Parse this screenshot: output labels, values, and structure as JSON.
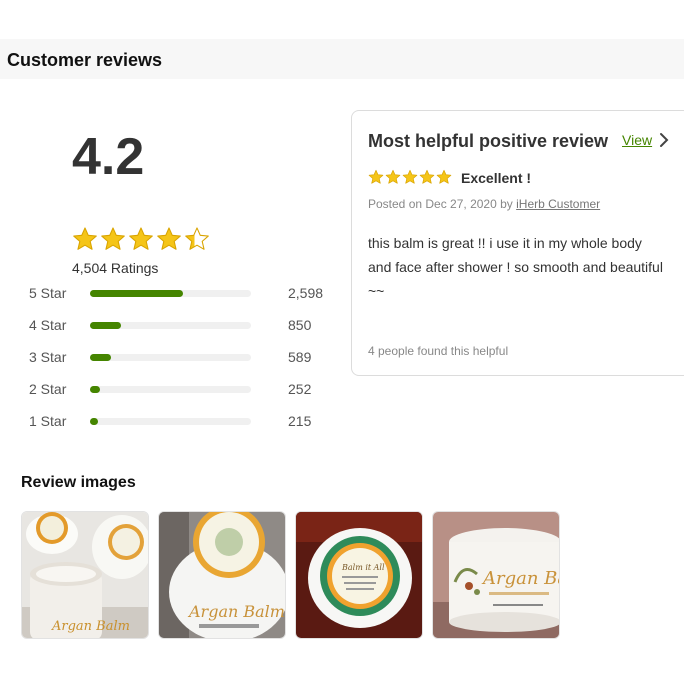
{
  "section_title": "Customer reviews",
  "summary": {
    "average": "4.2",
    "average_value": 4.2,
    "max_stars": 5,
    "ratings_label": "4,504 Ratings"
  },
  "histogram": [
    {
      "label": "5 Star",
      "count": "2,598",
      "fraction": 0.58
    },
    {
      "label": "4 Star",
      "count": "850",
      "fraction": 0.19
    },
    {
      "label": "3 Star",
      "count": "589",
      "fraction": 0.13
    },
    {
      "label": "2 Star",
      "count": "252",
      "fraction": 0.06
    },
    {
      "label": "1 Star",
      "count": "215",
      "fraction": 0.05
    }
  ],
  "helpful_review": {
    "title": "Most helpful positive review",
    "view_label": "View",
    "stars": 5,
    "headline": "Excellent !",
    "posted_prefix": "Posted on Dec 27, 2020 by",
    "author": "iHerb Customer",
    "body": "this balm is great !! i use it in my whole body and face after shower ! so smooth and beautiful ~~",
    "helpful_text": "4 people found this helpful"
  },
  "review_images": {
    "title": "Review images",
    "images": [
      {
        "name": "review-image-1"
      },
      {
        "name": "review-image-2",
        "label": "Argan Balm"
      },
      {
        "name": "review-image-3",
        "label": "Balm it All"
      },
      {
        "name": "review-image-4",
        "label": "Argan Balm"
      }
    ]
  },
  "colors": {
    "accent": "#458500",
    "star": "#f5c518",
    "star_stroke": "#d9a400"
  }
}
